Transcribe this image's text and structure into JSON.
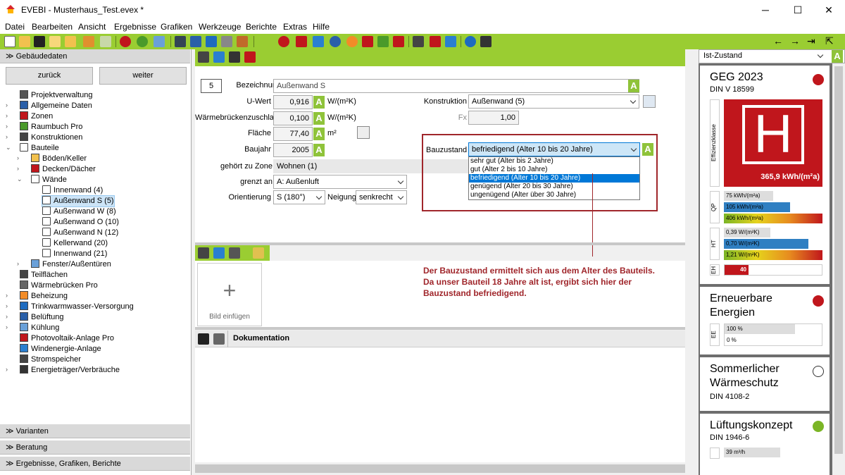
{
  "window": {
    "title": "EVEBI  -  Musterhaus_Test.evex *",
    "minimize": "─",
    "maximize": "☐",
    "close": "✕"
  },
  "menu": [
    "Datei",
    "Bearbeiten",
    "Ansicht",
    "Ergebnisse",
    "Grafiken",
    "Werkzeuge",
    "Berichte",
    "Extras",
    "Hilfe"
  ],
  "left": {
    "header": "Gebäudedaten",
    "back": "zurück",
    "forward": "weiter",
    "tree": [
      "Projektverwaltung",
      "Allgemeine Daten",
      "Zonen",
      "Raumbuch Pro",
      "Konstruktionen",
      "Bauteile",
      "Böden/Keller",
      "Decken/Dächer",
      "Wände",
      "Innenwand (4)",
      "Außenwand S (5)",
      "Außenwand W (8)",
      "Außenwand O (10)",
      "Außenwand N (12)",
      "Kellerwand (20)",
      "Innenwand (21)",
      "Fenster/Außentüren",
      "Teilflächen",
      "Wärmebrücken Pro",
      "Beheizung",
      "Trinkwarmwasser-Versorgung",
      "Belüftung",
      "Kühlung",
      "Photovoltaik-Anlage Pro",
      "Windenergie-Anlage",
      "Stromspeicher",
      "Energieträger/Verbräuche"
    ],
    "bottom": [
      "Varianten",
      "Beratung",
      "Ergebnisse, Grafiken, Berichte"
    ]
  },
  "form": {
    "nr": "5",
    "bezeichnung_label": "Bezeichnung",
    "bezeichnung": "Außenwand S",
    "uwert_label": "U-Wert",
    "uwert": "0,916",
    "uwert_unit": "W/(m²K)",
    "wb_label": "Wärmebrückenzuschlag",
    "wb": "0,100",
    "wb_unit": "W/(m²K)",
    "flaeche_label": "Fläche",
    "flaeche": "77,40",
    "flaeche_unit": "m²",
    "baujahr_label": "Baujahr",
    "baujahr": "2005",
    "zone_label": "gehört zu Zone",
    "zone": "Wohnen (1)",
    "grenzt_label": "grenzt an",
    "grenzt": "A: Außenluft",
    "orient_label": "Orientierung",
    "orient": "S (180°)",
    "neigung_label": "Neigung",
    "neigung": "senkrecht",
    "konstruktion_label": "Konstruktion",
    "konstruktion": "Außenwand (5)",
    "fx_label": "Fx",
    "fx": "1,00",
    "bauzustand_label": "Bauzustand",
    "bauzustand": "befriedigend (Alter 10 bis 20 Jahre)",
    "bauzustand_options": [
      "sehr gut (Alter bis 2 Jahre)",
      "gut (Alter 2 bis 10 Jahre)",
      "befriedigend (Alter 10 bis 20 Jahre)",
      "genügend (Alter 20 bis 30 Jahre)",
      "ungenügend (Alter über 30 Jahre)"
    ],
    "badge": "A"
  },
  "annotation": "Der Bauzustand ermittelt sich aus dem Alter des Bauteils.\nDa unser Bauteil 18 Jahre alt ist, ergibt sich hier der\nBauzustand befriedigend.",
  "image": {
    "plus": "+",
    "label": "Bild einfügen"
  },
  "doc": {
    "title": "Dokumentation"
  },
  "right": {
    "dropdown": "Ist-Zustand",
    "geg": {
      "title": "GEG 2023",
      "sub": "DIN V 18599",
      "class": "H",
      "vlabel": "Effizienzklasse",
      "value": "365,9 kWh/(m²a)",
      "qp_label": "QP",
      "qp": [
        "75 kWh/(m²a)",
        "105 kWh/(m²a)",
        "406 kWh/(m²a)"
      ],
      "ht_label": "HT",
      "ht": [
        "0,39 W/(m²K)",
        "0,70 W/(m²K)",
        "1,21 W/(m²K)"
      ],
      "eh_label": "EH",
      "eh": "40"
    },
    "ee": {
      "title1": "Erneuerbare",
      "title2": "Energien",
      "label": "EE",
      "v1": "100 %",
      "v2": "0 %"
    },
    "sw": {
      "title1": "Sommerlicher",
      "title2": "Wärmeschutz",
      "sub": "DIN 4108-2"
    },
    "lk": {
      "title": "Lüftungskonzept",
      "sub": "DIN 1946-6",
      "v1": "39 m³/h"
    }
  },
  "colors": {
    "accent": "#9acd32",
    "red": "#c0161c",
    "green": "#7bb526",
    "selection": "#0078d7"
  }
}
